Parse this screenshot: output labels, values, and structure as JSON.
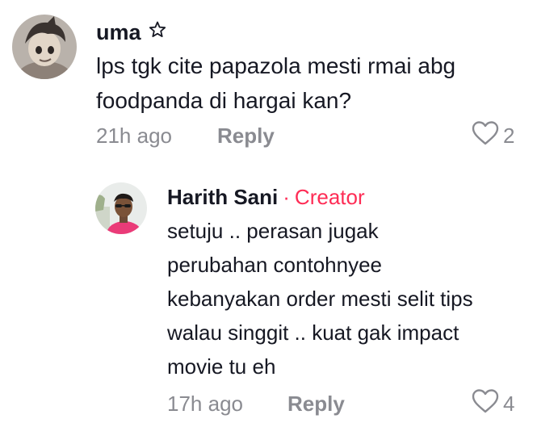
{
  "comments": [
    {
      "username": "uma",
      "badge_icon": "star-outline-icon",
      "text_lines": [
        "lps tgk cite papazola mesti rmai abg",
        "foodpanda di hargai kan?"
      ],
      "time": "21h ago",
      "reply_label": "Reply",
      "like_icon": "heart-outline-icon",
      "like_count": "2"
    },
    {
      "username": "Harith Sani",
      "separator": "·",
      "role_label": "Creator",
      "text_lines": [
        "setuju .. perasan jugak",
        "perubahan contohnyee",
        "kebanyakan order mesti selit tips",
        "walau singgit .. kuat gak impact",
        "movie tu eh"
      ],
      "time": "17h ago",
      "reply_label": "Reply",
      "like_icon": "heart-outline-icon",
      "like_count": "4"
    }
  ],
  "colors": {
    "text": "#161823",
    "muted": "#8a8b91",
    "creator": "#fe2c55"
  }
}
